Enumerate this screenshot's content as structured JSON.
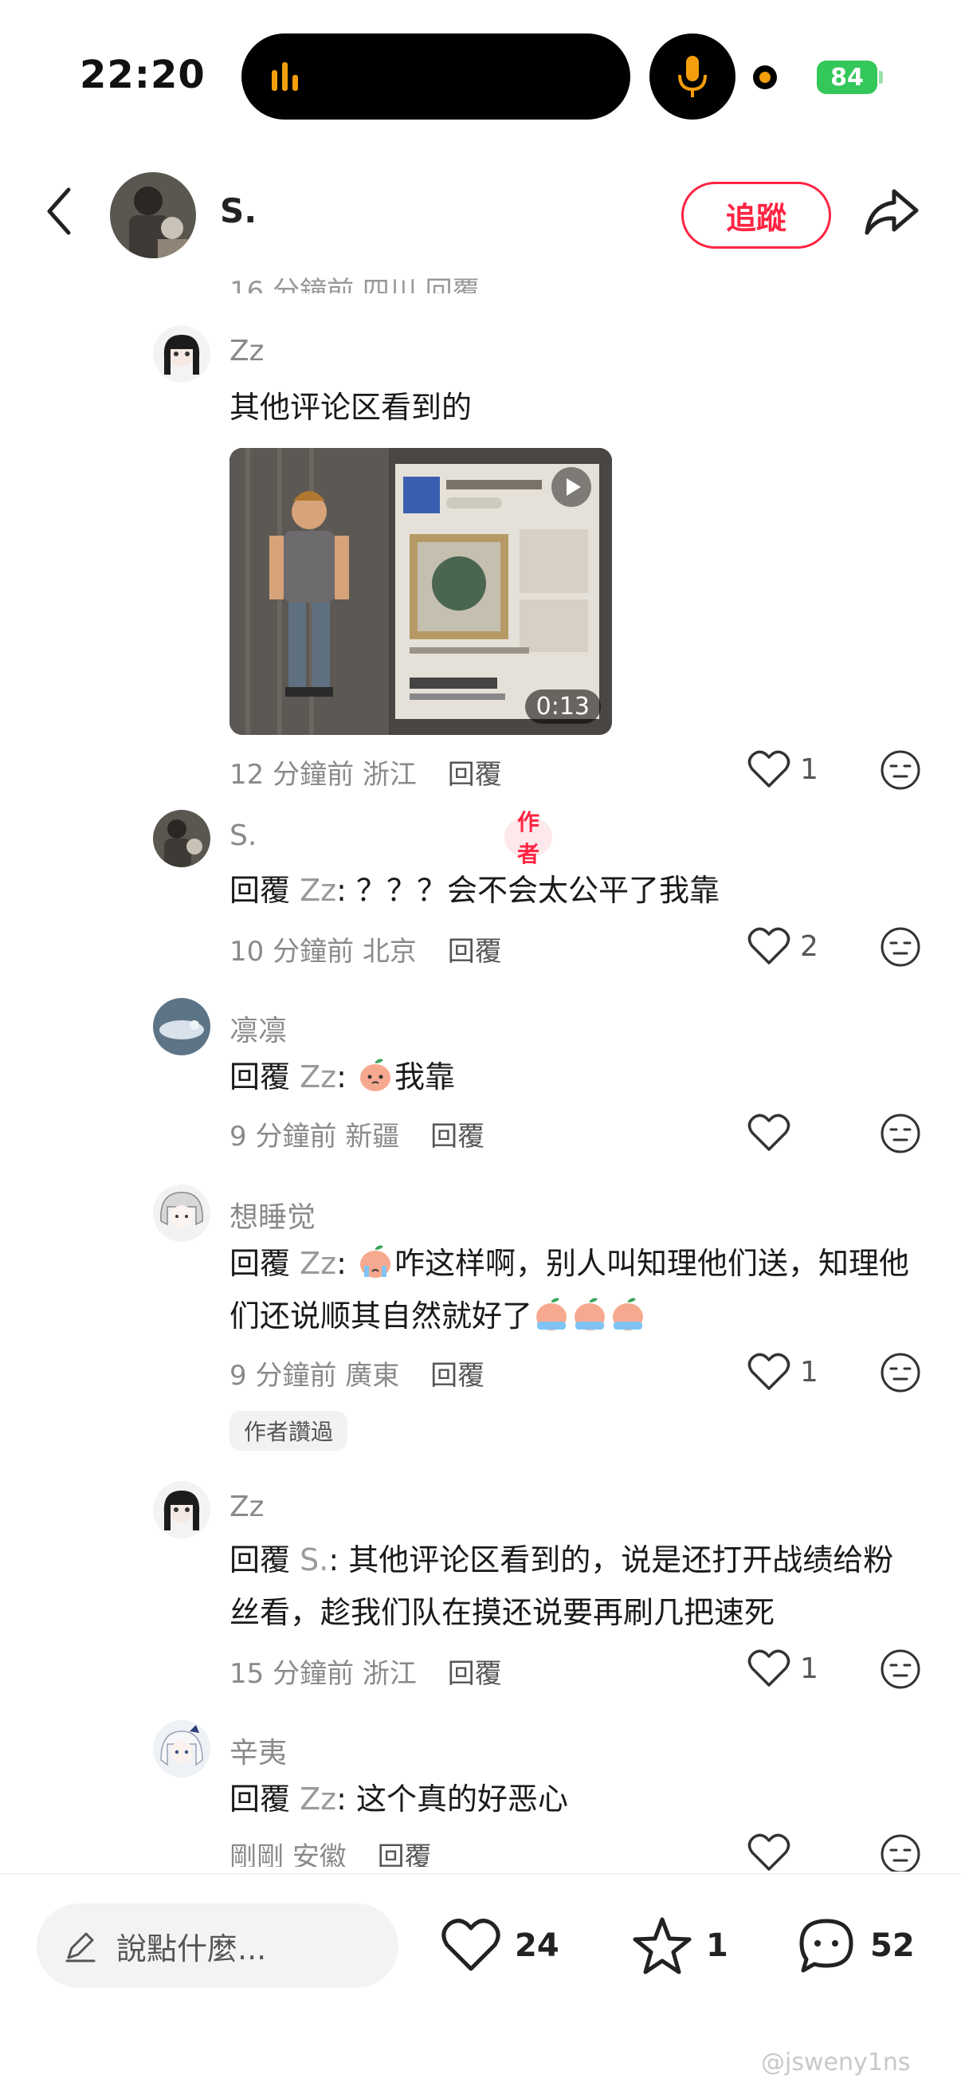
{
  "status_bar": {
    "time": "22:20",
    "battery": "84"
  },
  "header": {
    "name": "S.",
    "follow_label": "追蹤"
  },
  "partial_line": "16 分鐘前 四川  回覆",
  "comments": [
    {
      "name": "Zz",
      "text": "其他评论区看到的",
      "video_duration": "0:13",
      "time": "12 分鐘前",
      "location": "浙江",
      "reply_label": "回覆",
      "likes": "1"
    },
    {
      "name": "S.",
      "author_tag": "作者",
      "reply_prefix": "回覆",
      "reply_to": "Zz",
      "text": ": ？？？会不会太公平了我靠",
      "time": "10 分鐘前",
      "location": "北京",
      "reply_label": "回覆",
      "likes": "2"
    },
    {
      "name": "凛凛",
      "reply_prefix": "回覆",
      "reply_to": "Zz",
      "text": "我靠",
      "time": "9 分鐘前",
      "location": "新疆",
      "reply_label": "回覆",
      "likes": ""
    },
    {
      "name": "想睡觉",
      "reply_prefix": "回覆",
      "reply_to": "Zz",
      "text": "咋这样啊，别人叫知理他们送，知理他们还说顺其自然就好了",
      "time": "9 分鐘前",
      "location": "廣東",
      "reply_label": "回覆",
      "likes": "1",
      "author_read": "作者讚過"
    },
    {
      "name": "Zz",
      "reply_prefix": "回覆",
      "reply_to": "S.",
      "text": ": 其他评论区看到的，说是还打开战绩给粉丝看，趁我们队在摸还说要再刷几把速死",
      "time": "15 分鐘前",
      "location": "浙江",
      "reply_label": "回覆",
      "likes": "1"
    },
    {
      "name": "辛夷",
      "reply_prefix": "回覆",
      "reply_to": "Zz",
      "text": ": 这个真的好恶心",
      "time": "剛剛",
      "location": "安徽",
      "reply_label": "回覆",
      "likes": ""
    }
  ],
  "bottom_bar": {
    "placeholder": "說點什麼...",
    "likes": "24",
    "stars": "1",
    "comments": "52"
  },
  "watermark": "@jsweny1ns",
  "colors": {
    "accent": "#ff2442",
    "battery": "#34c759",
    "island_accent": "#f59e0b"
  }
}
